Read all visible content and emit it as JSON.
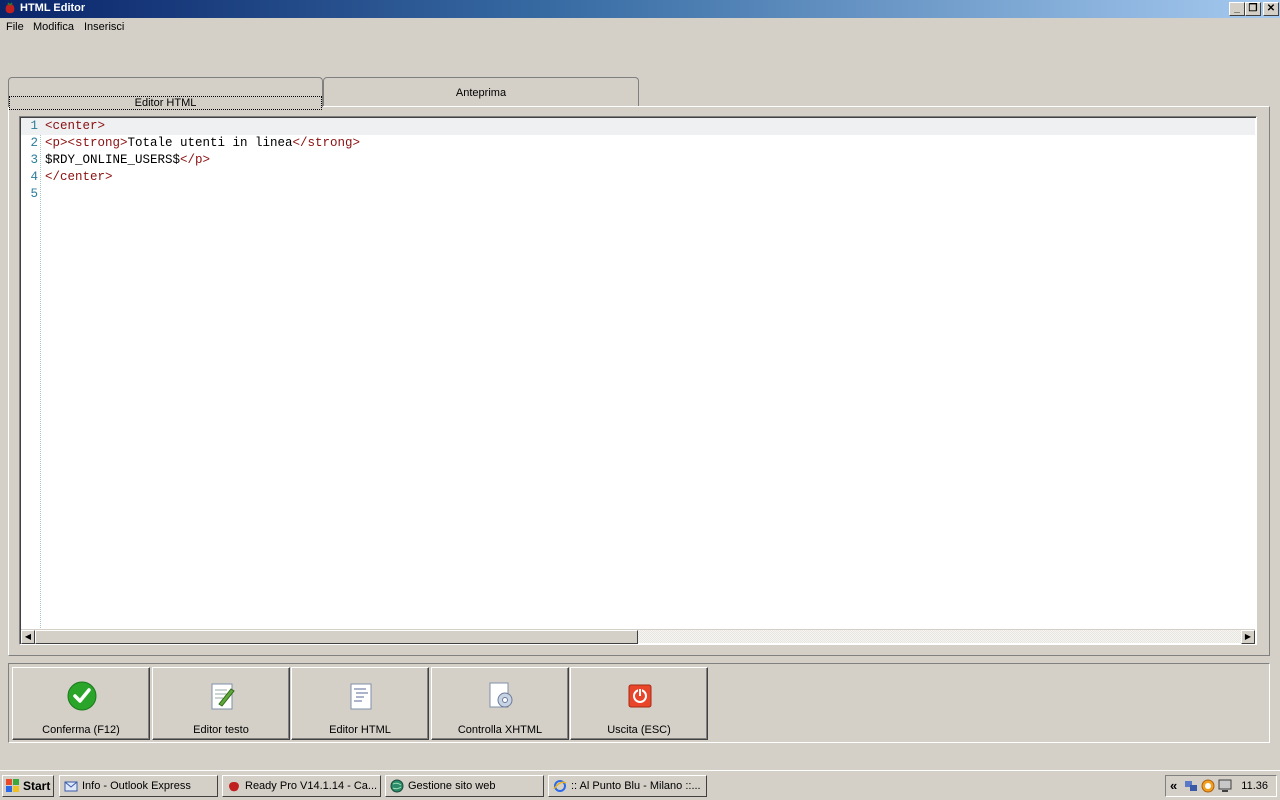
{
  "window": {
    "title": "HTML Editor",
    "controls": [
      "_",
      "❐",
      "✕"
    ]
  },
  "menu": [
    "File",
    "Modifica",
    "Inserisci"
  ],
  "tabs": [
    {
      "label": "Editor HTML",
      "active": true
    },
    {
      "label": "Anteprima",
      "active": false
    }
  ],
  "editor": {
    "line_numbers": [
      "1",
      "2",
      "3",
      "4",
      "5"
    ],
    "lines": [
      {
        "tag1": "<center>",
        "text": "",
        "tag2": ""
      },
      {
        "tag1": "<p><strong>",
        "text": "Totale utenti in linea",
        "tag2": "</strong>"
      },
      {
        "tag1": "",
        "text": "$RDY_ONLINE_USERS$",
        "tag2": "</p>"
      },
      {
        "tag1": "</center>",
        "text": "",
        "tag2": ""
      },
      {
        "tag1": "",
        "text": "",
        "tag2": ""
      }
    ],
    "current_line": 1
  },
  "toolbar": [
    {
      "label": "Conferma (F12)",
      "icon": "check-icon"
    },
    {
      "label": "Editor testo",
      "icon": "edit-text-icon"
    },
    {
      "label": "Editor HTML",
      "icon": "html-document-icon"
    },
    {
      "label": "Controlla XHTML",
      "icon": "gear-document-icon"
    },
    {
      "label": "Uscita (ESC)",
      "icon": "power-icon"
    }
  ],
  "taskbar": {
    "start": "Start",
    "tasks": [
      "Info - Outlook Express",
      "Ready Pro V14.1.14 - Ca...",
      "Gestione sito web",
      ":: Al Punto Blu - Milano ::..."
    ],
    "clock": "11.36"
  },
  "colors": {
    "tag": "#8b1010",
    "line_numbers": "#2a7d9a",
    "title_gradient_start": "#0a246a",
    "title_gradient_end": "#a6caf0"
  }
}
